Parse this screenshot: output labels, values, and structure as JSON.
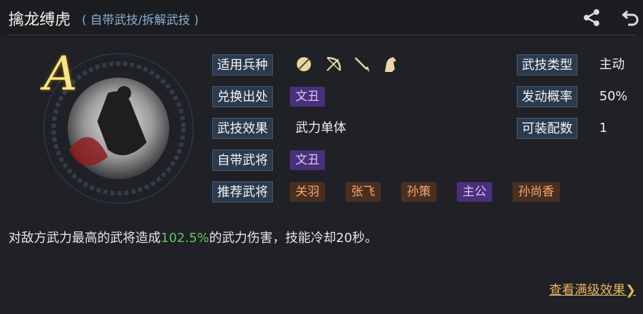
{
  "header": {
    "title": "擒龙缚虎",
    "subtitle": "( 自带武技/拆解武技 )"
  },
  "skill": {
    "grade": "A",
    "applicable_units_label": "适用兵种",
    "units": [
      "shield-icon",
      "bow-icon",
      "spear-icon",
      "horse-icon"
    ],
    "source_label": "兑换出处",
    "source_value": "文丑",
    "effect_label": "武技效果",
    "effect_value": "武力单体",
    "own_general_label": "自带武将",
    "own_general_value": "文丑",
    "recommend_label": "推荐武将",
    "recommend": [
      {
        "name": "关羽",
        "color": "orange"
      },
      {
        "name": "张飞",
        "color": "orange"
      },
      {
        "name": "孙策",
        "color": "orange"
      },
      {
        "name": "主公",
        "color": "purple"
      },
      {
        "name": "孙尚香",
        "color": "orange"
      }
    ],
    "type_label": "武技类型",
    "type_value": "主动",
    "chance_label": "发动概率",
    "chance_value": "50%",
    "equip_label": "可装配数",
    "equip_value": "1"
  },
  "description": {
    "before": "对敌方武力最高的武将造成",
    "highlight": "102.5%",
    "after": "的武力伤害，技能冷却20秒。"
  },
  "footer": {
    "more_label": "查看满级效果",
    "more_arrow": "❯"
  },
  "colors": {
    "highlight": "#63c263",
    "link": "#e6b45a",
    "purple_tag": "#4a2f7a",
    "orange_tag": "#4a2f1f"
  }
}
